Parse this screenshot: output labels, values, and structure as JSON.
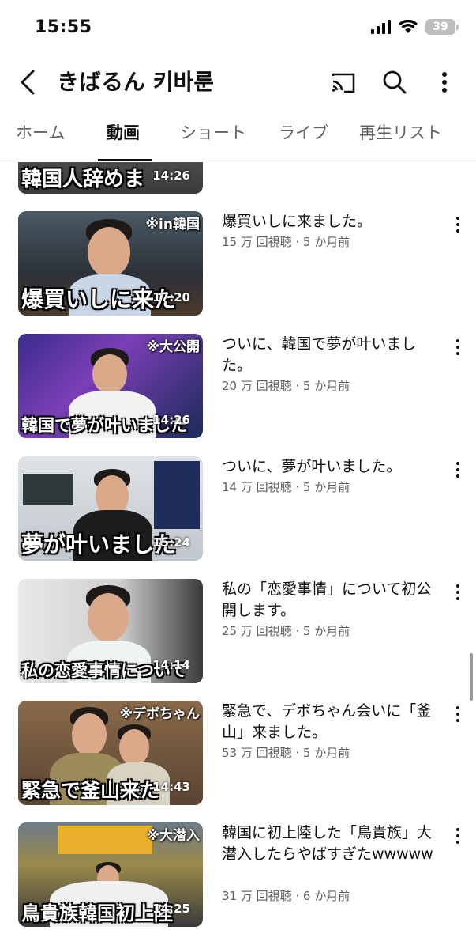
{
  "status_bar": {
    "time": "15:55",
    "battery": "39"
  },
  "header": {
    "channel_name": "きばるん 키바룬",
    "icons": [
      "back-arrow-icon",
      "cast-icon",
      "search-icon",
      "more-vert-icon"
    ]
  },
  "tabs": [
    {
      "label": "ホーム",
      "active": false
    },
    {
      "label": "動画",
      "active": true
    },
    {
      "label": "ショート",
      "active": false
    },
    {
      "label": "ライブ",
      "active": false
    },
    {
      "label": "再生リスト",
      "active": false
    }
  ],
  "videos": [
    {
      "title": "",
      "meta": "",
      "duration": "14:26",
      "thumb_caption": "韓国人辞めま",
      "thumb_badge": ""
    },
    {
      "title": "爆買いしに来ました。",
      "meta": "15 万 回視聴 · 5 か月前",
      "duration": "17:20",
      "thumb_caption": "爆買いしに来た",
      "thumb_badge": "※in韓国"
    },
    {
      "title": "ついに、韓国で夢が叶いました。",
      "meta": "20 万 回視聴 · 5 か月前",
      "duration": "14:26",
      "thumb_caption": "韓国で夢が叶いました",
      "thumb_badge": "※大公開"
    },
    {
      "title": "ついに、夢が叶いました。",
      "meta": "14 万 回視聴 · 5 か月前",
      "duration": "15:24",
      "thumb_caption": "夢が叶いました",
      "thumb_badge": ""
    },
    {
      "title": "私の「恋愛事情」について初公開します。",
      "meta": "25 万 回視聴 · 5 か月前",
      "duration": "14:14",
      "thumb_caption": "私の恋愛事情について",
      "thumb_badge": ""
    },
    {
      "title": "緊急で、デボちゃん会いに「釜山」来ました。",
      "meta": "53 万 回視聴 · 5 か月前",
      "duration": "14:43",
      "thumb_caption": "緊急で釜山来た",
      "thumb_badge": "※デボちゃん"
    },
    {
      "title": "韓国に初上陸した「鳥貴族」大潜入したらやばすぎたwwwww",
      "meta": "31 万 回視聴 · 6 か月前",
      "duration": "14:25",
      "thumb_caption": "鳥貴族韓国初上陸",
      "thumb_badge": "※大潜入"
    }
  ]
}
